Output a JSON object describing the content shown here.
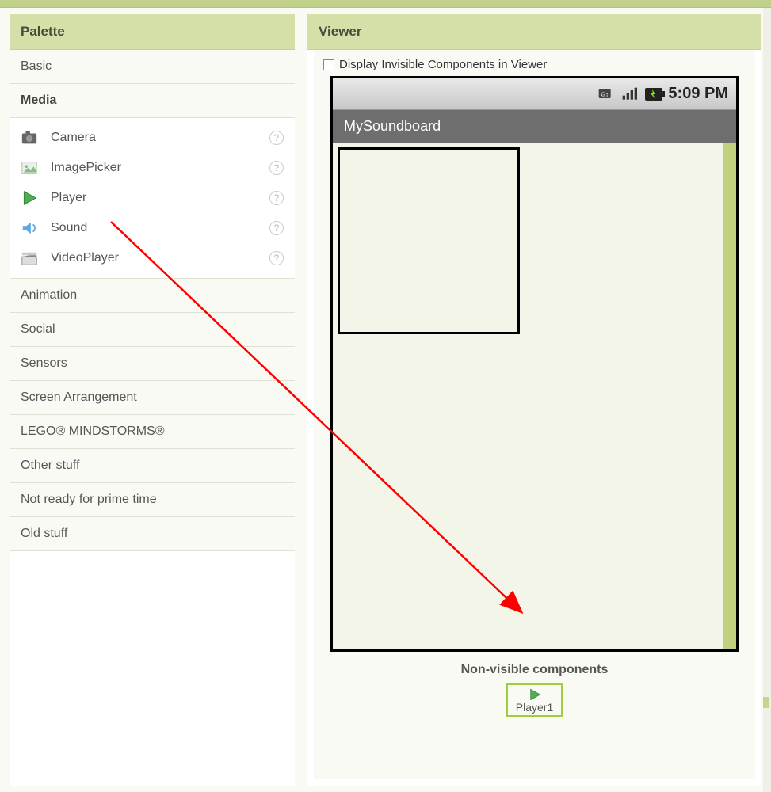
{
  "palette": {
    "title": "Palette",
    "categories": [
      "Basic",
      "Media",
      "Animation",
      "Social",
      "Sensors",
      "Screen Arrangement",
      "LEGO® MINDSTORMS®",
      "Other stuff",
      "Not ready for prime time",
      "Old stuff"
    ],
    "selected_category": "Media",
    "media_items": [
      {
        "icon": "camera-icon",
        "label": "Camera"
      },
      {
        "icon": "image-icon",
        "label": "ImagePicker"
      },
      {
        "icon": "play-icon",
        "label": "Player"
      },
      {
        "icon": "sound-icon",
        "label": "Sound"
      },
      {
        "icon": "clap-icon",
        "label": "VideoPlayer"
      }
    ]
  },
  "viewer": {
    "title": "Viewer",
    "checkbox_label": "Display Invisible Components in Viewer",
    "checkbox_checked": false,
    "status_time": "5:09 PM",
    "app_title": "MySoundboard",
    "nonvisible_label": "Non-visible components",
    "nonvisible_items": [
      {
        "icon": "play-icon",
        "label": "Player1"
      }
    ]
  },
  "annotation": {
    "type": "drag-arrow",
    "from_component": "Player",
    "to": "Non-visible components area",
    "color": "#ff0000"
  }
}
